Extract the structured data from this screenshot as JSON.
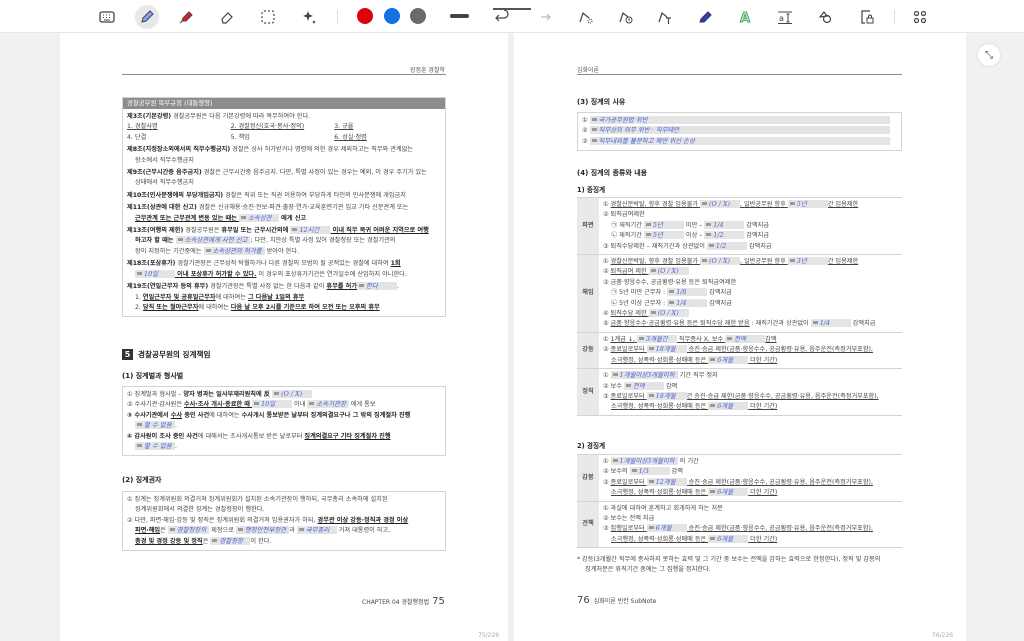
{
  "toolbar": {
    "tools": [
      "keyboard-icon",
      "pen-icon",
      "highlighter-icon",
      "eraser-icon",
      "lasso-select-icon",
      "magic-icon"
    ],
    "active_tool": "pen-icon",
    "colors": [
      "#d9040f",
      "#1270e0",
      "#6a6a6a"
    ],
    "right_tools": [
      "shape-recognition-icon",
      "timer-icon",
      "text-to-shape-icon",
      "blue-highlighter-icon",
      "text-outline-icon",
      "text-box-icon",
      "shapes-icon",
      "page-lock-icon"
    ],
    "grid_icon": "apps-grid-icon"
  },
  "left": {
    "header": "장정훈 경찰학",
    "box_title": "경찰공무원 복무규정 (대통령령)",
    "box_lines": [
      {
        "s": [
          [
            "b",
            "제3조(기본강령)"
          ],
          [
            "n",
            " 경찰공무원은 다음 기본강령에 따라 복무하여야 한다."
          ]
        ]
      },
      {
        "cols": [
          [
            [
              "u",
              "1. 경찰사명"
            ]
          ],
          [
            [
              "u",
              "2. 경찰정신(호국·봉사·정의)"
            ]
          ],
          [
            [
              "u",
              "3. 규율"
            ]
          ]
        ]
      },
      {
        "cols": [
          [
            [
              "n",
              "4. 단결"
            ]
          ],
          [
            [
              "n",
              "5. 책임"
            ]
          ],
          [
            [
              "u",
              "6. 성실·청렴"
            ]
          ]
        ]
      },
      {
        "g": 1,
        "s": [
          [
            "b",
            "제8조(지정장소외에서의 직무수행금지)"
          ],
          [
            "n",
            " 경찰은 상사 허가받거나 명령에 의한 경우 제외하고는 직무와 관계없는"
          ]
        ]
      },
      {
        "i": 1,
        "s": [
          [
            "n",
            "장소에서 직무수행금지"
          ]
        ]
      },
      {
        "g": 1,
        "s": [
          [
            "b",
            "제9조(근무시간중 음주금지)"
          ],
          [
            "n",
            " 경찰은 근무시간중 음주금지. 다만, 특별 사정이 있는 경우는 예외, 이 경우 주기가 있는"
          ]
        ]
      },
      {
        "i": 1,
        "s": [
          [
            "n",
            "상태에서 직무수행금지"
          ]
        ]
      },
      {
        "g": 1,
        "s": [
          [
            "b",
            "제10조(민사분쟁에의 부당개입금지)"
          ],
          [
            "n",
            " 경찰은 직위 또는 직권 이용하여 부당하게 타인의 민사분쟁에 개입금지"
          ]
        ]
      },
      {
        "g": 1,
        "s": [
          [
            "b",
            "제11조(상관에 대한 신고)"
          ],
          [
            "n",
            " 경찰은 신규채용·승진·전보·파견·출장·연가·교육훈련기관 입교 기타 신분관계 또는"
          ]
        ]
      },
      {
        "i": 1,
        "s": [
          [
            "bu",
            "근무관계 또는 근무관계 변동 있는 때는 "
          ],
          [
            "hw",
            "소속상관"
          ],
          [
            "b",
            " 에게 신고"
          ]
        ]
      },
      {
        "g": 1,
        "s": [
          [
            "b",
            "제13조(여행의 제한)"
          ],
          [
            "n",
            " 경찰공무원은 "
          ],
          [
            "b",
            "휴무일 또는 근무시간외에 "
          ],
          [
            "hw",
            "12시간"
          ],
          [
            "bu",
            " 이내 직무 복귀 어려운 지역으로 여행"
          ]
        ]
      },
      {
        "i": 1,
        "s": [
          [
            "b",
            "하고자 할 때는 "
          ],
          [
            "hw",
            "소속상관에게 사전 신고"
          ],
          [
            "n",
            "; 다만, 치안상 특별 사정 있어 경찰청장 또는 경찰기관의"
          ]
        ]
      },
      {
        "i": 1,
        "s": [
          [
            "n",
            "장이 지정하는 기간중에는 "
          ],
          [
            "hw",
            "소속상관의 허가를"
          ],
          [
            "n",
            " 받아야 한다."
          ]
        ]
      },
      {
        "g": 1,
        "s": [
          [
            "b",
            "제18조(포상휴가)"
          ],
          [
            "n",
            " 경찰기관장은 근무성적 탁월하거나 다른 경찰의 모범이 될 공적있는 경찰에 대하여 "
          ],
          [
            "bu",
            "1회"
          ]
        ]
      },
      {
        "i": 1,
        "s": [
          [
            "hw",
            "10일"
          ],
          [
            "bu",
            " 이내 포상휴가 허가할 수 있다."
          ],
          [
            "n",
            " 이 경우의 포상휴가기간은 연가일수에 산입하지 아니한다."
          ]
        ]
      },
      {
        "g": 1,
        "s": [
          [
            "b",
            "제19조(연일근무자 등의 휴무)"
          ],
          [
            "n",
            " 경찰기관장은 특별 사정 없는 한 다음과 같이 "
          ],
          [
            "bu",
            "휴무를 허가"
          ],
          [
            "hw",
            "한다"
          ],
          [
            "n",
            "."
          ]
        ]
      },
      {
        "i": 1,
        "s": [
          [
            "n",
            "1. "
          ],
          [
            "bu",
            "연일근무자 및 공휴일근무자"
          ],
          [
            "n",
            "에 대하여는 "
          ],
          [
            "bu",
            "그 다음날 1일의 휴무"
          ]
        ]
      },
      {
        "i": 1,
        "s": [
          [
            "n",
            "2. "
          ],
          [
            "bu",
            "당직 또는 철야근무자"
          ],
          [
            "n",
            "에 대하여는 "
          ],
          [
            "bu",
            "다음 날 오후 2시를 기준으로 하여 오전 또는 오후의 휴무"
          ]
        ]
      }
    ],
    "section_num": "5",
    "section_title": "경찰공무원의 징계책임",
    "s1_title": "(1) 징계벌과 형사벌",
    "s1_lines": [
      {
        "s": [
          [
            "n",
            "① 징계벌과 형사벌 – "
          ],
          [
            "b",
            "양자 병과는 일사부재리원칙에 反 "
          ],
          [
            "hw",
            "(O / X)"
          ]
        ]
      },
      {
        "s": [
          [
            "n",
            "② 수사기관·감사원은 "
          ],
          [
            "bu",
            "수사·조사 개시·종료한 때 "
          ],
          [
            "hw",
            "10일"
          ],
          [
            "n",
            " 이내 "
          ],
          [
            "hw",
            "소속기관장"
          ],
          [
            "n",
            " 에게 통보"
          ]
        ]
      },
      {
        "s": [
          [
            "b",
            "③ 수사기관에서 "
          ],
          [
            "bu",
            "수사"
          ],
          [
            "b",
            " 중인 사건"
          ],
          [
            "n",
            "에 대하여는 "
          ],
          [
            "b",
            "수사개시 통보받은 날부터 징계의결요구나 그 밖의 징계절차 진행"
          ]
        ]
      },
      {
        "i": 1,
        "s": [
          [
            "hw",
            "할 수 없음"
          ],
          [
            "n",
            "."
          ]
        ]
      },
      {
        "s": [
          [
            "b",
            "④ 감사원이 조사 중인 사건"
          ],
          [
            "n",
            "에 대해서는 조사개시통보 받은 날로부터 "
          ],
          [
            "bu",
            "징계의결요구 기타 징계절차 진행"
          ]
        ]
      },
      {
        "i": 1,
        "s": [
          [
            "hw",
            "할 수 없음"
          ],
          [
            "n",
            "."
          ]
        ]
      }
    ],
    "s2_title": "(2) 징계권자",
    "s2_lines": [
      {
        "s": [
          [
            "n",
            "① 징계는 징계위원회 의결거쳐 징계위원회가 설치된 소속기관장이 행하되, 국무총리 소속하에 설치된"
          ]
        ]
      },
      {
        "i": 1,
        "s": [
          [
            "n",
            "징계위원회에서 의결한 징계는 경찰청장이 행한다."
          ]
        ]
      },
      {
        "s": [
          [
            "n",
            "② 다만, 파면·해임·강등 및 정직은 징계위원회 의결거쳐 임용권자가 하되, "
          ],
          [
            "bu",
            "경무관 이상 강등·정직과 경정 이상"
          ]
        ]
      },
      {
        "i": 1,
        "s": [
          [
            "bu",
            "파면·해임"
          ],
          [
            "n",
            "은 "
          ],
          [
            "hw",
            "경찰청장의"
          ],
          [
            "n",
            " 제청으로 "
          ],
          [
            "hw",
            "행정안전부장관"
          ],
          [
            "n",
            "과 "
          ],
          [
            "hw",
            "국무총리"
          ],
          [
            "n",
            " 거쳐 대통령이 하고,"
          ]
        ]
      },
      {
        "i": 1,
        "s": [
          [
            "bu",
            "총경 및 경정 강등 및 정직"
          ],
          [
            "n",
            "은 "
          ],
          [
            "hw",
            "경찰청장"
          ],
          [
            "n",
            "이 한다."
          ]
        ]
      }
    ],
    "footer_chapter": "CHAPTER 04 경찰행정법",
    "footer_page": "75",
    "counter": "75/226"
  },
  "right": {
    "header": "심화이론",
    "s3_title": "(3) 징계의 사유",
    "s3_lines": [
      {
        "s": [
          [
            "n",
            "① "
          ],
          [
            "hw",
            "국가공무원법 위반"
          ]
        ]
      },
      {
        "s": [
          [
            "n",
            "② "
          ],
          [
            "hw",
            "직무상의 의무 위반 · 직무태만"
          ]
        ]
      },
      {
        "s": [
          [
            "n",
            "③ "
          ],
          [
            "hw",
            "직무내외를 불문하고 체면 위신 손상"
          ]
        ]
      }
    ],
    "s4_title": "(4) 징계의 종류와 내용",
    "sub1": "1) 중징계",
    "rows1": [
      {
        "label": "파면",
        "lines": [
          {
            "s": [
              [
                "n",
                "① "
              ],
              [
                "u",
                "경찰신분박탈, 향후 경찰 임용불가 "
              ],
              [
                "hw",
                "(O / X)"
              ],
              [
                "u",
                ", 일반공무원 향후 "
              ],
              [
                "hw",
                "5년"
              ],
              [
                "u",
                "간 임용제한"
              ]
            ]
          },
          {
            "s": [
              [
                "n",
                "② 퇴직급여제한"
              ]
            ]
          },
          {
            "i": 1,
            "s": [
              [
                "n",
                "㉠ 재직기간 "
              ],
              [
                "hw",
                "5년"
              ],
              [
                "n",
                " 미만 – "
              ],
              [
                "hw",
                "1/4"
              ],
              [
                "n",
                " 감액지급"
              ]
            ]
          },
          {
            "i": 1,
            "s": [
              [
                "n",
                "㉡ 재직기간 "
              ],
              [
                "hw",
                "5년"
              ],
              [
                "n",
                " 이상 – "
              ],
              [
                "hw",
                "1/2"
              ],
              [
                "n",
                " 감액지급"
              ]
            ]
          },
          {
            "s": [
              [
                "n",
                "③ 퇴직수당제한 – 재직기간과 상관없이 "
              ],
              [
                "hw",
                "1/2"
              ],
              [
                "n",
                " 감액지급"
              ]
            ]
          }
        ]
      },
      {
        "label": "해임",
        "lines": [
          {
            "s": [
              [
                "n",
                "① "
              ],
              [
                "u",
                "경찰신분박탈, 향후 경찰 임용불가 "
              ],
              [
                "hw",
                "(O / X)"
              ],
              [
                "u",
                ", 일반공무원 향후 "
              ],
              [
                "hw",
                "3년"
              ],
              [
                "u",
                "간 임용제한"
              ]
            ]
          },
          {
            "s": [
              [
                "n",
                "② "
              ],
              [
                "u",
                "퇴직급여 제한 "
              ],
              [
                "hw",
                "(O / X)"
              ]
            ]
          },
          {
            "s": [
              [
                "n",
                "③ 금품·향응수수, 공금횡령·유용 등은 퇴직급여제한"
              ]
            ]
          },
          {
            "i": 1,
            "s": [
              [
                "n",
                "㉠ 5년 미만 근무자 : "
              ],
              [
                "hw",
                "1/8"
              ],
              [
                "n",
                " 감액지급"
              ]
            ]
          },
          {
            "i": 1,
            "s": [
              [
                "n",
                "㉡ 5년 이상 근무자 : "
              ],
              [
                "hw",
                "1/4"
              ],
              [
                "n",
                " 감액지급"
              ]
            ]
          },
          {
            "s": [
              [
                "n",
                "④ "
              ],
              [
                "u",
                "퇴직수당 제한 "
              ],
              [
                "hw",
                "(O / X)"
              ]
            ]
          },
          {
            "s": [
              [
                "n",
                "⑤ "
              ],
              [
                "u",
                "금품·향응수수·공금횡령·유용 등은 퇴직수당 제한 받음"
              ],
              [
                "n",
                " : 재직기간과 상관없이 "
              ],
              [
                "hw",
                "1/4"
              ],
              [
                "n",
                " 감액지급"
              ]
            ]
          }
        ]
      },
      {
        "label": "강등",
        "lines": [
          {
            "s": [
              [
                "n",
                "① "
              ],
              [
                "u",
                "1계급 ↓, "
              ],
              [
                "hw",
                "3개월간"
              ],
              [
                "u",
                " 직무종사 X, 보수 "
              ],
              [
                "hw",
                "전액"
              ],
              [
                "u",
                "감액"
              ]
            ]
          },
          {
            "s": [
              [
                "n",
                "② "
              ],
              [
                "u",
                "종료일로부터 "
              ],
              [
                "hw",
                "18개월"
              ],
              [
                "u",
                " 승진·승급 제한(금품·향응수수, 공금횡령·유용, 음주운전(측정거부포함),"
              ]
            ]
          },
          {
            "i": 1,
            "s": [
              [
                "u",
                "소극행정, 성폭력·성희롱·성매매 등은 "
              ],
              [
                "hw",
                "6개월"
              ],
              [
                "u",
                " 더한 기간)"
              ]
            ]
          }
        ]
      },
      {
        "label": "정직",
        "lines": [
          {
            "s": [
              [
                "n",
                "① "
              ],
              [
                "hw",
                "1개월이상3개월이하"
              ],
              [
                "n",
                " 기간 직무 정지"
              ]
            ]
          },
          {
            "s": [
              [
                "n",
                "② 보수 "
              ],
              [
                "hw",
                "전액"
              ],
              [
                "n",
                " 감액"
              ]
            ]
          },
          {
            "s": [
              [
                "n",
                "③ "
              ],
              [
                "u",
                "종료일로부터 "
              ],
              [
                "hw",
                "18개월"
              ],
              [
                "u",
                "간 승진·승급 제한(금품·향응수수, 공금횡령·유용, 음주운전(측정거부포함),"
              ]
            ]
          },
          {
            "i": 1,
            "s": [
              [
                "u",
                "소극행정, 성폭력·성희롱·성매매 등은 "
              ],
              [
                "hw",
                "6개월"
              ],
              [
                "u",
                " 더한 기간)"
              ]
            ]
          }
        ]
      }
    ],
    "sub2": "2) 경징계",
    "rows2": [
      {
        "label": "감봉",
        "lines": [
          {
            "s": [
              [
                "n",
                "① "
              ],
              [
                "hw",
                "1개월이상3개월이하"
              ],
              [
                "n",
                " 의 기간"
              ]
            ]
          },
          {
            "s": [
              [
                "n",
                "② 보수의 "
              ],
              [
                "hw",
                "1/3"
              ],
              [
                "n",
                " 감액"
              ]
            ]
          },
          {
            "s": [
              [
                "n",
                "③ "
              ],
              [
                "u",
                "종료일로부터 "
              ],
              [
                "hw",
                "12개월"
              ],
              [
                "u",
                " 승진·승급 제한(금품·향응수수, 공금횡령·유용, 음주운전(측정거부포함),"
              ]
            ]
          },
          {
            "i": 1,
            "s": [
              [
                "u",
                "소극행정, 성폭력·성희롱·성매매 등은 "
              ],
              [
                "hw",
                "6개월"
              ],
              [
                "u",
                " 더한 기간)"
              ]
            ]
          }
        ]
      },
      {
        "label": "견책",
        "lines": [
          {
            "s": [
              [
                "n",
                "① 과실에 대하여 훈계하고 회개하게 하는 처분"
              ]
            ]
          },
          {
            "s": [
              [
                "n",
                "② 보수는 전액 지급"
              ]
            ]
          },
          {
            "s": [
              [
                "n",
                "③ "
              ],
              [
                "u",
                "집행일로부터 "
              ],
              [
                "hw",
                "6개월"
              ],
              [
                "u",
                " 승진·승급 제한(금품·향응수수, 공금횡령·유용, 음주운전(측정거부포함),"
              ]
            ]
          },
          {
            "i": 1,
            "s": [
              [
                "u",
                "소극행정, 성폭력·성희롱·성매매 등은 "
              ],
              [
                "hw",
                "6개월"
              ],
              [
                "u",
                " 더한 기간)"
              ]
            ]
          }
        ]
      }
    ],
    "footnote": [
      {
        "s": [
          [
            "n",
            "* 강등(3개월간 직무에 종사하지 못하는 효력 및 그 기간 중 보수는 전액을 감하는 효력으로 한정한다), 정직 및 감봉의"
          ]
        ]
      },
      {
        "i": 1,
        "s": [
          [
            "n",
            "징계처분은 휴직기간 중에는 그 집행을 정지한다."
          ]
        ]
      }
    ],
    "footer_page": "76",
    "footer_text": "심화이론 빈칸 SubNote",
    "counter": "76/226"
  },
  "collapse_icon": "collapse-arrows-icon"
}
